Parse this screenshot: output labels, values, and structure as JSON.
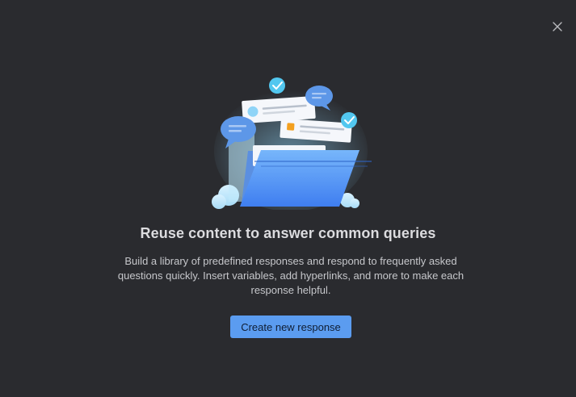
{
  "dialog": {
    "close_icon": "close-icon",
    "illustration_icon": "folder-with-responses-illustration",
    "title": "Reuse content to answer common queries",
    "description": "Build a library of predefined responses and respond to frequently asked questions quickly. Insert variables, add hyperlinks, and more to make each response helpful.",
    "cta_label": "Create new response"
  },
  "colors": {
    "background": "#2a2b2f",
    "accent": "#5b9cf0",
    "title": "#dcdcdf",
    "text": "#c6c7cb"
  }
}
